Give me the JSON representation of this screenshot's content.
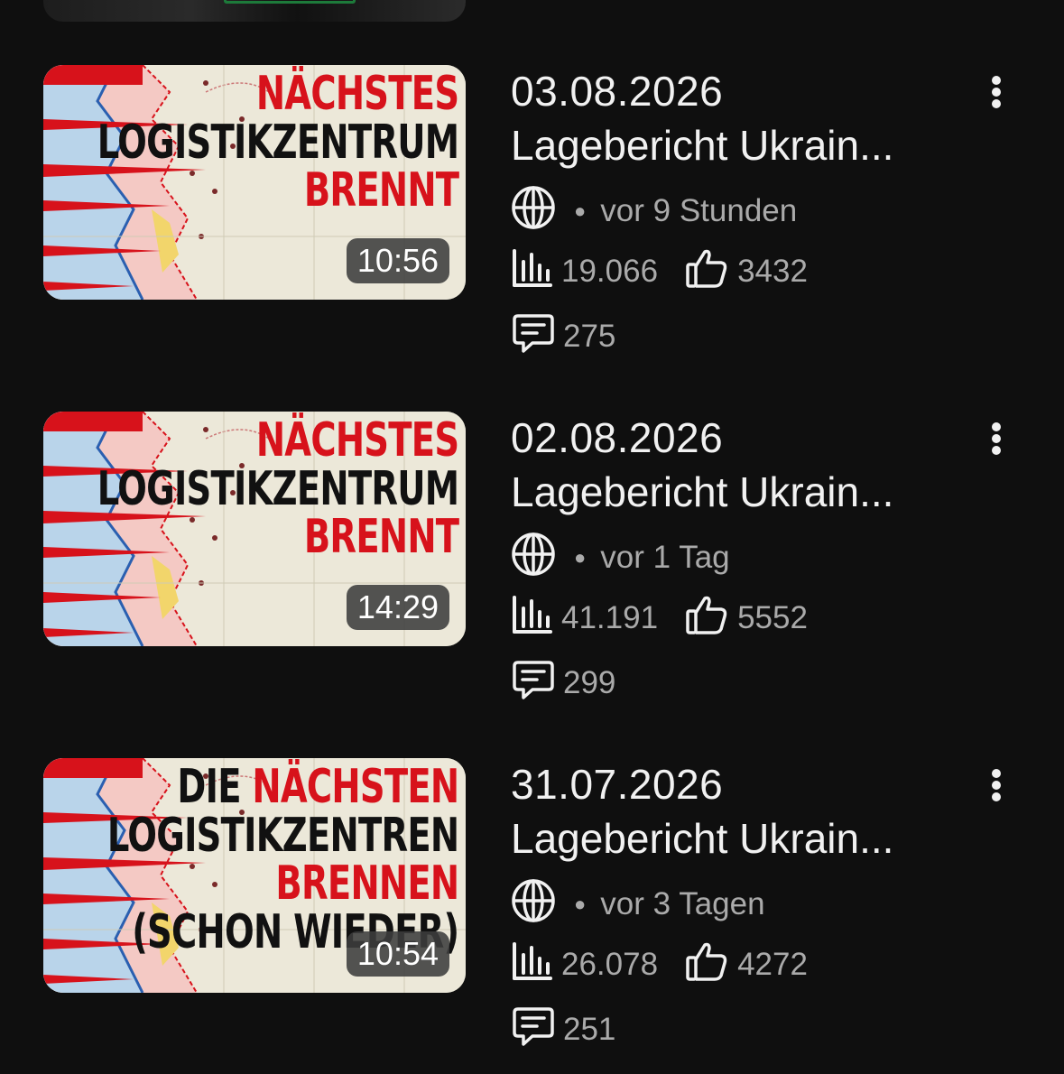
{
  "videos": [
    {
      "overlay_lines": [
        {
          "text": "NÄCHSTES",
          "color": "red"
        },
        {
          "text": "LOGISTIKZENTRUM",
          "color": "black"
        },
        {
          "text": "BRENNT",
          "color": "red"
        }
      ],
      "duration": "10:56",
      "date": "03.08.2026",
      "title": "Lagebericht Ukrain...",
      "age": "vor 9 Stunden",
      "views": "19.066",
      "likes": "3432",
      "comments": "275"
    },
    {
      "overlay_lines": [
        {
          "text": "NÄCHSTES",
          "color": "red"
        },
        {
          "text": "LOGISTIKZENTRUM",
          "color": "black"
        },
        {
          "text": "BRENNT",
          "color": "red"
        }
      ],
      "duration": "14:29",
      "date": "02.08.2026",
      "title": "Lagebericht Ukrain...",
      "age": "vor 1 Tag",
      "views": "41.191",
      "likes": "5552",
      "comments": "299"
    },
    {
      "overlay_lines": [
        {
          "parts": [
            {
              "text": "DIE ",
              "color": "black"
            },
            {
              "text": "NÄCHSTEN",
              "color": "red"
            }
          ]
        },
        {
          "text": "LOGISTIKZENTREN",
          "color": "black"
        },
        {
          "text": "BRENNEN",
          "color": "red"
        },
        {
          "text": "(SCHON WIEDER)",
          "color": "black"
        }
      ],
      "duration": "10:54",
      "date": "31.07.2026",
      "title": "Lagebericht Ukrain...",
      "age": "vor 3 Tagen",
      "views": "26.078",
      "likes": "4272",
      "comments": "251"
    }
  ],
  "icons": {
    "visibility": "globe-icon",
    "views": "bar-chart-icon",
    "likes": "thumbs-up-icon",
    "comments": "comment-icon",
    "menu": "more-vert-icon"
  },
  "colors": {
    "background": "#0f0f0f",
    "primary_text": "#f1f1f1",
    "secondary_text": "#aaaaaa",
    "thumbnail_red": "#d7121b"
  }
}
